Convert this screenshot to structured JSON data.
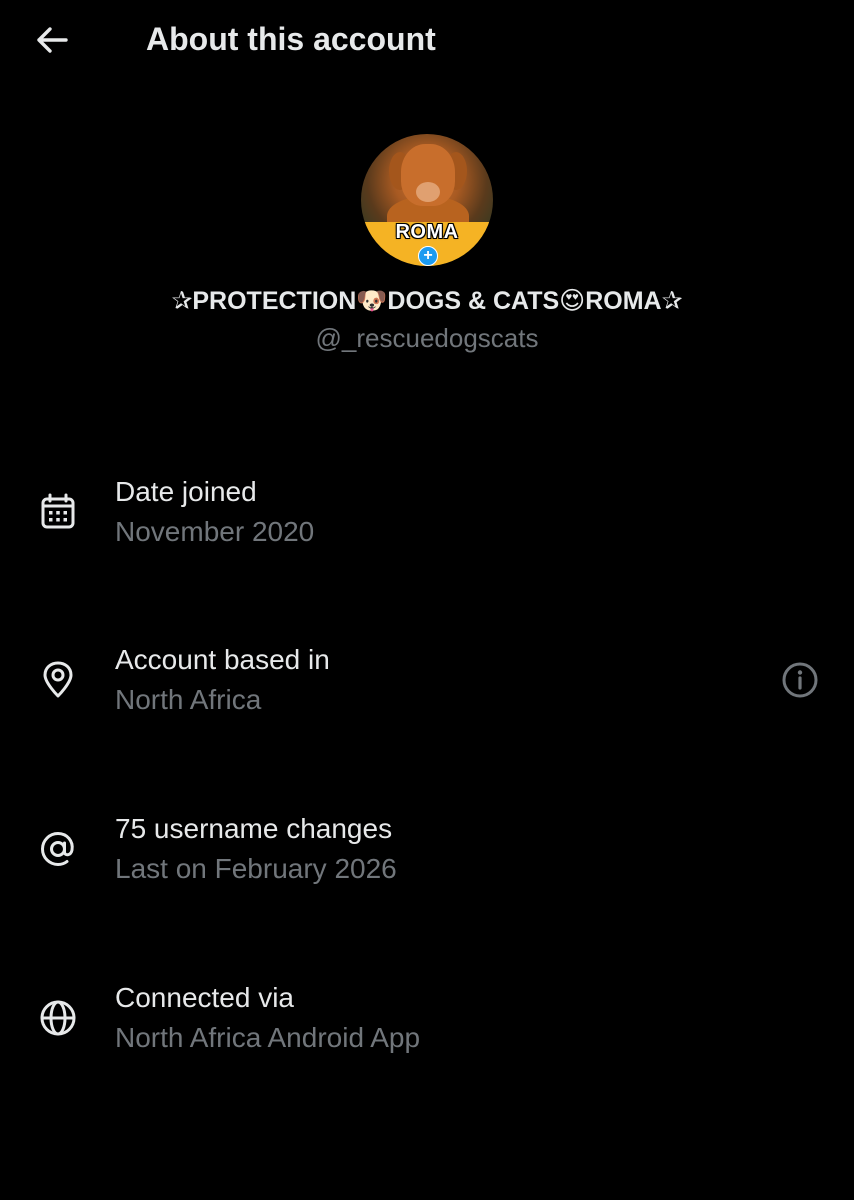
{
  "header": {
    "title": "About this account",
    "back_icon": "arrow-left-icon"
  },
  "profile": {
    "avatar_badge_text": "ROMA",
    "avatar_plus": "+",
    "display_name": "✰PROTECTION🐶DOGS & CATS😍ROMA✰",
    "handle": "@_rescuedogscats"
  },
  "rows": [
    {
      "icon": "calendar-icon",
      "title": "Date joined",
      "subtitle": "November 2020"
    },
    {
      "icon": "location-pin-icon",
      "title": "Account based in",
      "subtitle": "North Africa",
      "action_icon": "info-icon"
    },
    {
      "icon": "at-sign-icon",
      "title": "75 username changes",
      "subtitle": "Last on February 2026"
    },
    {
      "icon": "globe-icon",
      "title": "Connected via",
      "subtitle": "North Africa Android App"
    }
  ],
  "colors": {
    "background": "#000000",
    "primary_text": "#e7e9ea",
    "secondary_text": "#71767b",
    "avatar_band": "#f5b324"
  }
}
